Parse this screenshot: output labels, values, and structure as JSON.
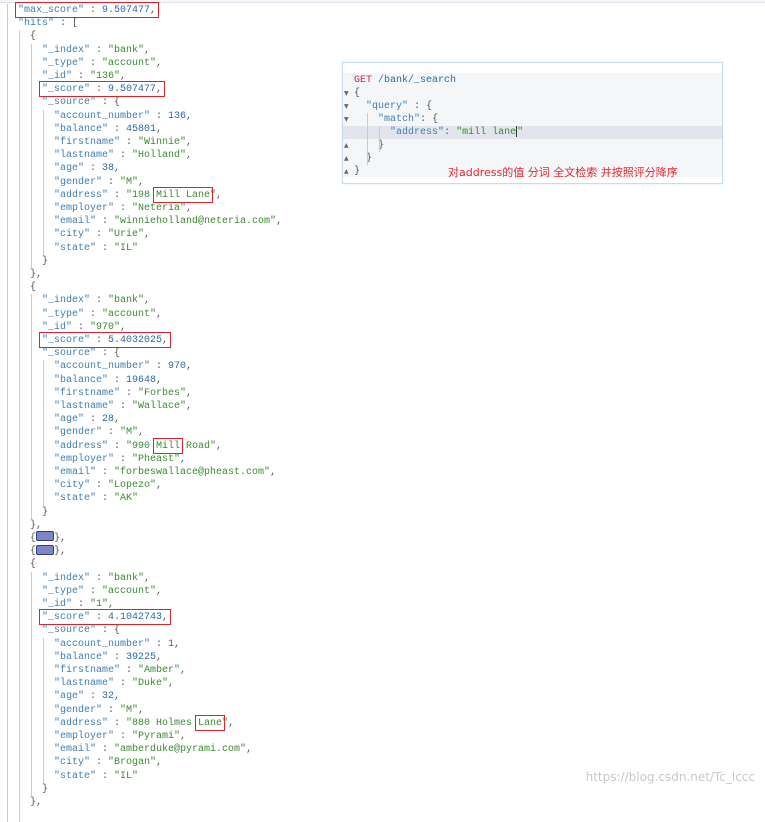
{
  "result": {
    "max_score": "9.507477",
    "hits_key": "hits",
    "hits": [
      {
        "_index": "bank",
        "_type": "account",
        "_id": "136",
        "_score": "9.507477",
        "source": [
          [
            "account_number",
            "136",
            "n"
          ],
          [
            "balance",
            "45801",
            "n"
          ],
          [
            "firstname",
            "Winnie",
            "s"
          ],
          [
            "lastname",
            "Holland",
            "s"
          ],
          [
            "age",
            "38",
            "n"
          ],
          [
            "gender",
            "M",
            "s"
          ],
          [
            "address",
            "198 Mill Lane",
            "s"
          ],
          [
            "employer",
            "Neteria",
            "s"
          ],
          [
            "email",
            "winnieholland@neteria.com",
            "s"
          ],
          [
            "city",
            "Urie",
            "s"
          ],
          [
            "state",
            "IL",
            "s"
          ]
        ],
        "highlight_term": "Mill Lane"
      },
      {
        "_index": "bank",
        "_type": "account",
        "_id": "970",
        "_score": "5.4032025",
        "source": [
          [
            "account_number",
            "970",
            "n"
          ],
          [
            "balance",
            "19648",
            "n"
          ],
          [
            "firstname",
            "Forbes",
            "s"
          ],
          [
            "lastname",
            "Wallace",
            "s"
          ],
          [
            "age",
            "28",
            "n"
          ],
          [
            "gender",
            "M",
            "s"
          ],
          [
            "address",
            "990 Mill Road",
            "s"
          ],
          [
            "employer",
            "Pheast",
            "s"
          ],
          [
            "email",
            "forbeswallace@pheast.com",
            "s"
          ],
          [
            "city",
            "Lopezo",
            "s"
          ],
          [
            "state",
            "AK",
            "s"
          ]
        ],
        "highlight_term": "Mill"
      },
      {
        "collapsed": true
      },
      {
        "collapsed": true
      },
      {
        "_index": "bank",
        "_type": "account",
        "_id": "1",
        "_score": "4.1042743",
        "source": [
          [
            "account_number",
            "1",
            "n"
          ],
          [
            "balance",
            "39225",
            "n"
          ],
          [
            "firstname",
            "Amber",
            "s"
          ],
          [
            "lastname",
            "Duke",
            "s"
          ],
          [
            "age",
            "32",
            "n"
          ],
          [
            "gender",
            "M",
            "s"
          ],
          [
            "address",
            "880 Holmes Lane",
            "s"
          ],
          [
            "employer",
            "Pyrami",
            "s"
          ],
          [
            "email",
            "amberduke@pyrami.com",
            "s"
          ],
          [
            "city",
            "Brogan",
            "s"
          ],
          [
            "state",
            "IL",
            "s"
          ]
        ],
        "highlight_term": "Lane"
      }
    ]
  },
  "query_panel": {
    "method": "GET",
    "path": "/bank/_search",
    "query_key": "query",
    "match_key": "match",
    "field": "address",
    "value": "mill lane",
    "note": "对address的值 分词 全文检索 并按照评分降序"
  },
  "watermark": "https://blog.csdn.net/Tc_lccc",
  "colors": {
    "highlight_box": "#e0202a",
    "key": "#3f7fb3",
    "string": "#3b8b32",
    "number": "#2a6aa8",
    "note": "#e8262d"
  }
}
